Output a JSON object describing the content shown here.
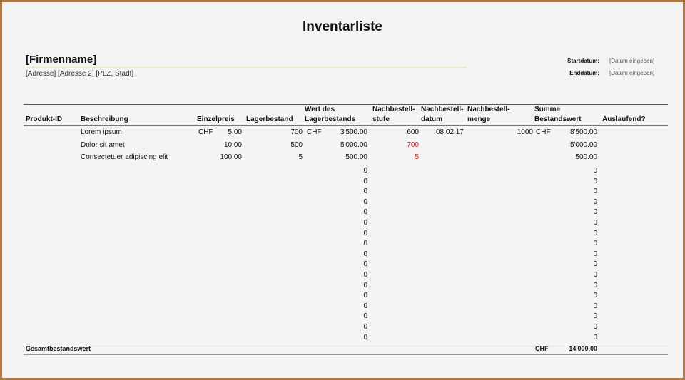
{
  "title": "Inventarliste",
  "company": {
    "name": "[Firmenname]",
    "address": "[Adresse] [Adresse 2] [PLZ, Stadt]"
  },
  "dates": {
    "start_label": "Startdatum:",
    "start_value": "[Datum eingeben]",
    "end_label": "Enddatum:",
    "end_value": "[Datum eingeben]"
  },
  "headers": {
    "produkt_id": "Produkt-ID",
    "beschreibung": "Beschreibung",
    "einzelpreis": "Einzelpreis",
    "lagerbestand": "Lagerbestand",
    "wert_1": "Wert des",
    "wert_2": "Lagerbestands",
    "stufe_1": "Nachbestell-",
    "stufe_2": "stufe",
    "datum_1": "Nachbestell-",
    "datum_2": "datum",
    "menge_1": "Nachbestell-",
    "menge_2": "menge",
    "summe_1": "Summe",
    "summe_2": "Bestandswert",
    "auslaufend": "Auslaufend?"
  },
  "items": [
    {
      "desc": "Lorem ipsum",
      "price_cur": "CHF",
      "price": "5.00",
      "stock": "700",
      "value_cur": "CHF",
      "value": "3'500.00",
      "level": "600",
      "level_alert": false,
      "date": "08.02.17",
      "qty": "1000",
      "sum_cur": "CHF",
      "sum": "8'500.00"
    },
    {
      "desc": "Dolor sit amet",
      "price_cur": "",
      "price": "10.00",
      "stock": "500",
      "value_cur": "",
      "value": "5'000.00",
      "level": "700",
      "level_alert": true,
      "date": "",
      "qty": "",
      "sum_cur": "",
      "sum": "5'000.00"
    },
    {
      "desc": "Consectetuer adipiscing elit",
      "price_cur": "",
      "price": "100.00",
      "stock": "5",
      "value_cur": "",
      "value": "500.00",
      "level": "5",
      "level_alert": true,
      "date": "",
      "qty": "",
      "sum_cur": "",
      "sum": "500.00"
    }
  ],
  "empty_rows": [
    "0",
    "0",
    "0",
    "0",
    "0",
    "0",
    "0",
    "0",
    "0",
    "0",
    "0",
    "0",
    "0",
    "0",
    "0",
    "0",
    "0"
  ],
  "total": {
    "label": "Gesamtbestandswert",
    "currency": "CHF",
    "value": "14'000.00"
  },
  "colors": {
    "alert": "#d02020",
    "border": "#b07a4a"
  }
}
